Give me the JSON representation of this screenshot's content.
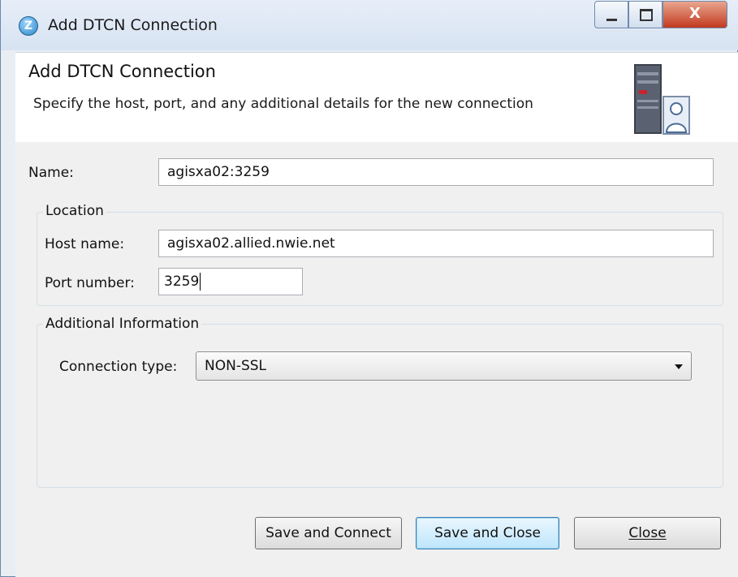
{
  "window": {
    "title": "Add DTCN Connection",
    "controls": {
      "minimize": "minimize",
      "maximize": "maximize",
      "close": "X"
    }
  },
  "banner": {
    "title": "Add DTCN Connection",
    "subtitle": "Specify the host, port, and any additional details for the new connection",
    "icon": "server-user-icon"
  },
  "form": {
    "name_label": "Name:",
    "name_value": "agisxa02:3259",
    "location": {
      "group_title": "Location",
      "host_label": "Host name:",
      "host_value": "agisxa02.allied.nwie.net",
      "port_label": "Port number:",
      "port_value": "3259"
    },
    "additional": {
      "group_title": "Additional Information",
      "connection_type_label": "Connection type:",
      "connection_type_value": "NON-SSL"
    }
  },
  "buttons": {
    "save_connect": "Save and Connect",
    "save_close": "Save and Close",
    "close": "Close"
  },
  "colors": {
    "close_button": "#c23a1f",
    "default_button_border": "#3c7fb1",
    "banner_bg": "#ffffff",
    "form_bg": "#f0f0f0"
  }
}
